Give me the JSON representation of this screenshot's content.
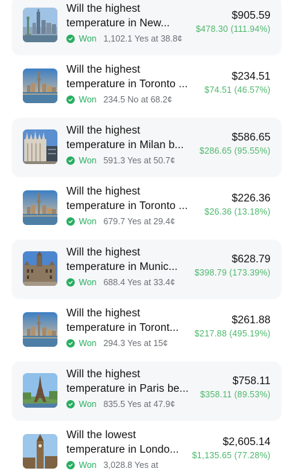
{
  "colors": {
    "won": "#27ae60",
    "gain": "#4cb86b",
    "muted": "#6b6f75"
  },
  "positions": [
    {
      "image": "new-york-skyline",
      "title_line1": "Will the highest",
      "title_line2": "temperature in New...",
      "status": "Won",
      "detail": "1,102.1 Yes at 38.8¢",
      "value": "$905.59",
      "gain": "$478.30 (111.94%)"
    },
    {
      "image": "toronto-skyline",
      "title_line1": "Will the highest",
      "title_line2": "temperature in Toronto ...",
      "status": "Won",
      "detail": "234.5 No at 68.2¢",
      "value": "$234.51",
      "gain": "$74.51 (46.57%)"
    },
    {
      "image": "milan-cathedral",
      "title_line1": "Will the highest",
      "title_line2": "temperature in Milan b...",
      "status": "Won",
      "detail": "591.3 Yes at 50.7¢",
      "value": "$586.65",
      "gain": "$286.65 (95.55%)"
    },
    {
      "image": "toronto-skyline",
      "title_line1": "Will the highest",
      "title_line2": "temperature in Toronto ...",
      "status": "Won",
      "detail": "679.7 Yes at 29.4¢",
      "value": "$226.36",
      "gain": "$26.36 (13.18%)"
    },
    {
      "image": "munich-town-hall",
      "title_line1": "Will the highest",
      "title_line2": "temperature in Munic...",
      "status": "Won",
      "detail": "688.4 Yes at 33.4¢",
      "value": "$628.79",
      "gain": "$398.79 (173.39%)"
    },
    {
      "image": "toronto-skyline",
      "title_line1": "Will the highest",
      "title_line2": "temperature in Toront...",
      "status": "Won",
      "detail": "294.3 Yes at 15¢",
      "value": "$261.88",
      "gain": "$217.88 (495.19%)"
    },
    {
      "image": "eiffel-tower",
      "title_line1": "Will the highest",
      "title_line2": "temperature in Paris be...",
      "status": "Won",
      "detail": "835.5 Yes at 47.9¢",
      "value": "$758.11",
      "gain": "$358.11 (89.53%)"
    },
    {
      "image": "big-ben",
      "title_line1": "Will the lowest",
      "title_line2": "temperature in Londo...",
      "status": "Won",
      "detail": "3,028.8 Yes at",
      "value": "$2,605.14",
      "gain": "$1,135.65 (77.28%)"
    }
  ]
}
